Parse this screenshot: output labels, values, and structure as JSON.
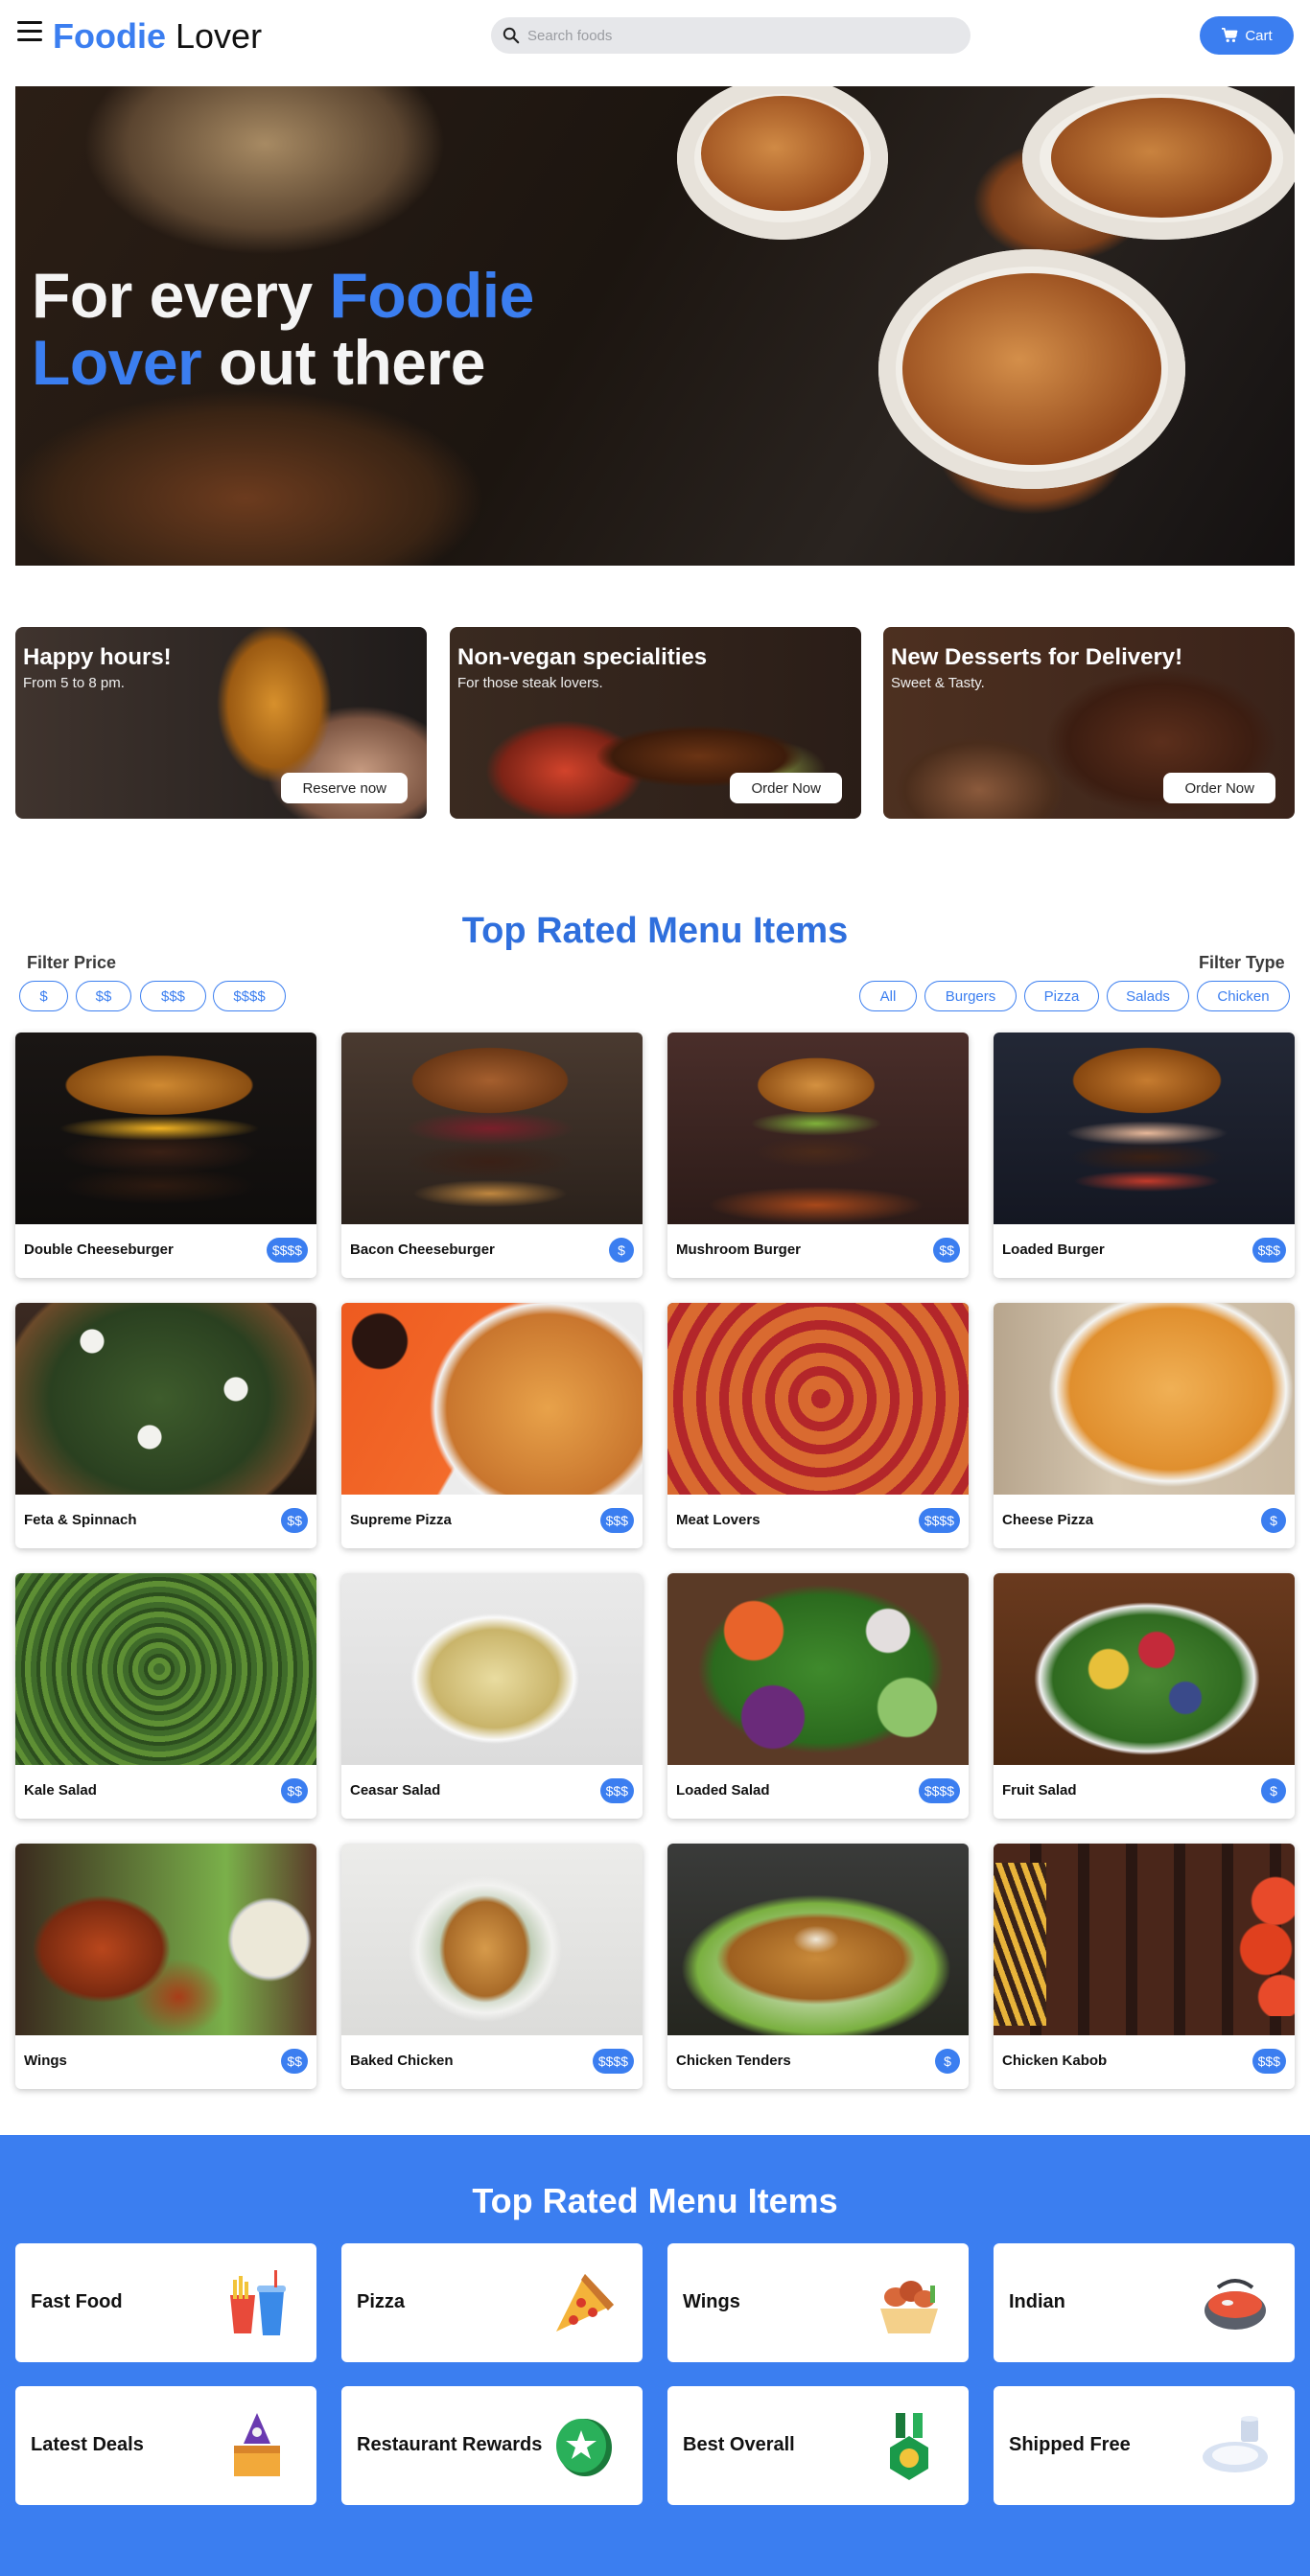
{
  "header": {
    "logo_part1": "Foodie",
    "logo_part2": "Lover",
    "search_placeholder": "Search foods",
    "cart_label": "Cart",
    "menu_icon": "hamburger-menu-icon",
    "search_icon": "search-icon",
    "cart_icon": "cart-icon"
  },
  "hero": {
    "line1_a": "For every ",
    "line1_b": "Foodie",
    "line2_a": "Lover",
    "line2_b": " out there"
  },
  "promos": [
    {
      "title": "Happy hours!",
      "subtitle": "From 5 to 8 pm.",
      "button": "Reserve now"
    },
    {
      "title": "Non-vegan specialities",
      "subtitle": "For those steak lovers.",
      "button": "Order Now"
    },
    {
      "title": "New Desserts for Delivery!",
      "subtitle": "Sweet & Tasty.",
      "button": "Order Now"
    }
  ],
  "menu_section": {
    "title": "Top Rated Menu Items",
    "filter_price_label": "Filter Price",
    "filter_type_label": "Filter Type",
    "price_filters": [
      "$",
      "$$",
      "$$$",
      "$$$$"
    ],
    "type_filters": [
      "All",
      "Burgers",
      "Pizza",
      "Salads",
      "Chicken"
    ]
  },
  "items": [
    {
      "name": "Double Cheeseburger",
      "price": "$$$$"
    },
    {
      "name": "Bacon Cheeseburger",
      "price": "$"
    },
    {
      "name": "Mushroom Burger",
      "price": "$$"
    },
    {
      "name": "Loaded Burger",
      "price": "$$$"
    },
    {
      "name": "Feta & Spinnach",
      "price": "$$"
    },
    {
      "name": "Supreme Pizza",
      "price": "$$$"
    },
    {
      "name": "Meat Lovers",
      "price": "$$$$"
    },
    {
      "name": "Cheese Pizza",
      "price": "$"
    },
    {
      "name": "Kale Salad",
      "price": "$$"
    },
    {
      "name": "Ceasar Salad",
      "price": "$$$"
    },
    {
      "name": "Loaded Salad",
      "price": "$$$$"
    },
    {
      "name": "Fruit Salad",
      "price": "$"
    },
    {
      "name": "Wings",
      "price": "$$"
    },
    {
      "name": "Baked Chicken",
      "price": "$$$$"
    },
    {
      "name": "Chicken Tenders",
      "price": "$"
    },
    {
      "name": "Chicken Kabob",
      "price": "$$$"
    }
  ],
  "category_section": {
    "title": "Top Rated Menu Items",
    "categories": [
      {
        "label": "Fast Food",
        "icon": "fast-food-icon"
      },
      {
        "label": "Pizza",
        "icon": "pizza-icon"
      },
      {
        "label": "Wings",
        "icon": "wings-icon"
      },
      {
        "label": "Indian",
        "icon": "indian-food-icon"
      },
      {
        "label": "Latest Deals",
        "icon": "deals-icon"
      },
      {
        "label": "Restaurant Rewards",
        "icon": "rewards-icon"
      },
      {
        "label": "Best Overall",
        "icon": "best-overall-icon"
      },
      {
        "label": "Shipped Free",
        "icon": "shipped-free-icon"
      }
    ]
  },
  "colors": {
    "accent": "#3b7ef0",
    "title_blue": "#2f6fdd",
    "search_bg": "#e6e7ea"
  }
}
